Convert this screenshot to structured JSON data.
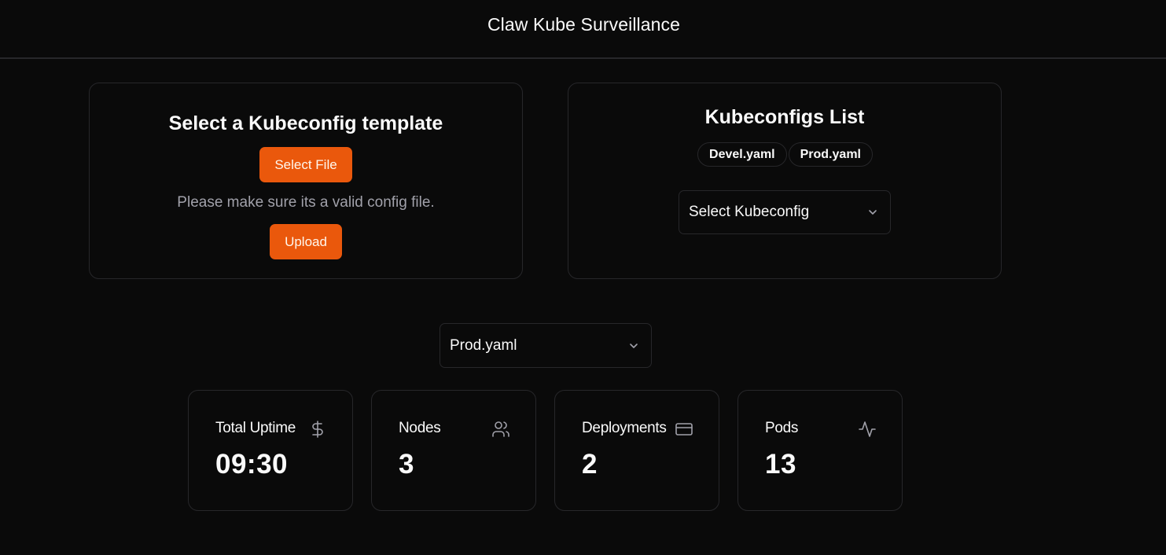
{
  "header": {
    "title": "Claw Kube Surveillance"
  },
  "upload_card": {
    "title": "Select a Kubeconfig template",
    "select_file_label": "Select File",
    "hint": "Please make sure its a valid config file.",
    "upload_label": "Upload"
  },
  "list_card": {
    "title": "Kubeconfigs List",
    "files": [
      "Devel.yaml",
      "Prod.yaml"
    ],
    "select_placeholder": "Select Kubeconfig"
  },
  "active_config": {
    "value": "Prod.yaml"
  },
  "stats": [
    {
      "label": "Total Uptime",
      "value": "09:30",
      "icon": "dollar-icon"
    },
    {
      "label": "Nodes",
      "value": "3",
      "icon": "users-icon"
    },
    {
      "label": "Deployments",
      "value": "2",
      "icon": "credit-card-icon"
    },
    {
      "label": "Pods",
      "value": "13",
      "icon": "activity-icon"
    }
  ],
  "colors": {
    "background": "#0a0a0a",
    "accent": "#ea580c",
    "border": "#27272a",
    "text": "#fafafa",
    "muted": "#a1a1aa"
  }
}
